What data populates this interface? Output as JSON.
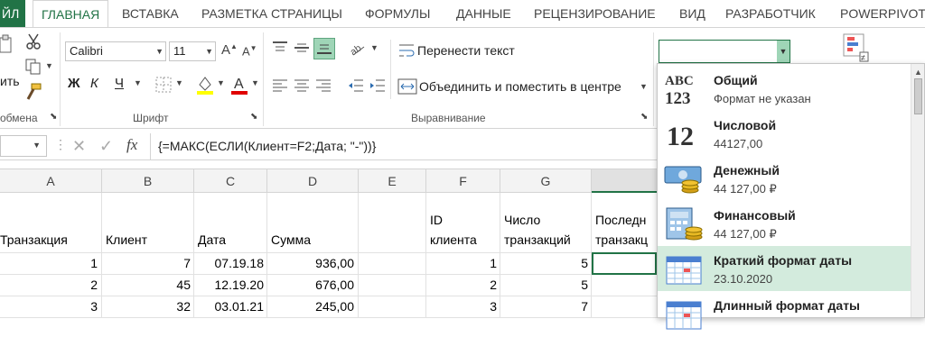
{
  "tabs": [
    {
      "label": "ЙЛ"
    },
    {
      "label": "ГЛАВНАЯ"
    },
    {
      "label": "ВСТАВКА"
    },
    {
      "label": "РАЗМЕТКА СТРАНИЦЫ"
    },
    {
      "label": "ФОРМУЛЫ"
    },
    {
      "label": "ДАННЫЕ"
    },
    {
      "label": "РЕЦЕНЗИРОВАНИЕ"
    },
    {
      "label": "ВИД"
    },
    {
      "label": "РАЗРАБОТЧИК"
    },
    {
      "label": "POWERPIVOT"
    }
  ],
  "ribbon": {
    "clipboard_paste_partial": "ить",
    "clipboard_group": "обмена",
    "font_name": "Calibri",
    "font_size": "11",
    "bold": "Ж",
    "italic": "К",
    "underline": "Ч",
    "font_group": "Шрифт",
    "wrap_text": "Перенести текст",
    "merge_center": "Объединить и поместить в центре",
    "alignment_group": "Выравнивание",
    "number_format_value": "",
    "accent_color": "#217346"
  },
  "formula_bar": {
    "fx": "fx",
    "formula": "{=МАКС(ЕСЛИ(Клиент=F2;Дата; \"-\"))}"
  },
  "columns": [
    "A",
    "B",
    "C",
    "D",
    "E",
    "F",
    "G",
    ""
  ],
  "headers": {
    "a": "Транзакция",
    "b": "Клиент",
    "c": "Дата",
    "d": "Сумма",
    "f1": "ID",
    "f2": "клиента",
    "g1": "Число",
    "g2": "транзакций",
    "h1": "Последн",
    "h2": "транзакц"
  },
  "rows": [
    {
      "a": "1",
      "b": "7",
      "c": "07.19.18",
      "d": "936,00",
      "f": "1",
      "g": "5"
    },
    {
      "a": "2",
      "b": "45",
      "c": "12.19.20",
      "d": "676,00",
      "f": "2",
      "g": "5"
    },
    {
      "a": "3",
      "b": "32",
      "c": "03.01.21",
      "d": "245,00",
      "f": "3",
      "g": "7"
    }
  ],
  "number_formats": [
    {
      "name": "Общий",
      "example": "Формат не указан",
      "icon": "abc-123-icon"
    },
    {
      "name": "Числовой",
      "example": "44127,00",
      "icon": "number-12-icon"
    },
    {
      "name": "Денежный",
      "example": "44 127,00 ₽",
      "icon": "currency-icon"
    },
    {
      "name": "Финансовый",
      "example": " 44 127,00 ₽",
      "icon": "accounting-icon"
    },
    {
      "name": "Краткий формат даты",
      "example": "23.10.2020",
      "icon": "calendar-icon"
    },
    {
      "name": "Длинный формат даты",
      "example": "",
      "icon": "calendar-icon"
    }
  ]
}
